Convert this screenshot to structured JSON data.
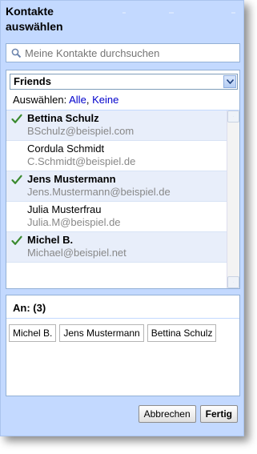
{
  "dialog": {
    "title_line1": "Kontakte",
    "title_line2": "auswählen"
  },
  "search": {
    "placeholder": "Meine Kontakte durchsuchen",
    "icon": "magnifier-icon"
  },
  "group_select": {
    "selected": "Friends"
  },
  "selection": {
    "prefix": "Auswählen:",
    "all_link": "Alle",
    "separator": ",",
    "none_link": "Keine"
  },
  "contacts": [
    {
      "name": "Bettina Schulz",
      "email": "BSchulz@beispiel.com",
      "selected": true
    },
    {
      "name": "Cordula Schmidt",
      "email": "C.Schmidt@beispiel.de",
      "selected": false
    },
    {
      "name": "Jens Mustermann",
      "email": "Jens.Mustermann@beispiel.de",
      "selected": true
    },
    {
      "name": "Julia Musterfrau",
      "email": "Julia.M@beispiel.de",
      "selected": false
    },
    {
      "name": "Michel B.",
      "email": "Michael@beispiel.net",
      "selected": true
    }
  ],
  "recipients": {
    "label": "An: (3)",
    "chips": [
      "Michel B.",
      "Jens Mustermann",
      "Bettina Schulz"
    ]
  },
  "buttons": {
    "cancel": "Abbrechen",
    "done": "Fertig"
  },
  "colors": {
    "dialog_bg": "#c3d9ff",
    "selected_row_bg": "#e8eefa",
    "link": "#0000cc",
    "check": "#3a8a2e"
  }
}
